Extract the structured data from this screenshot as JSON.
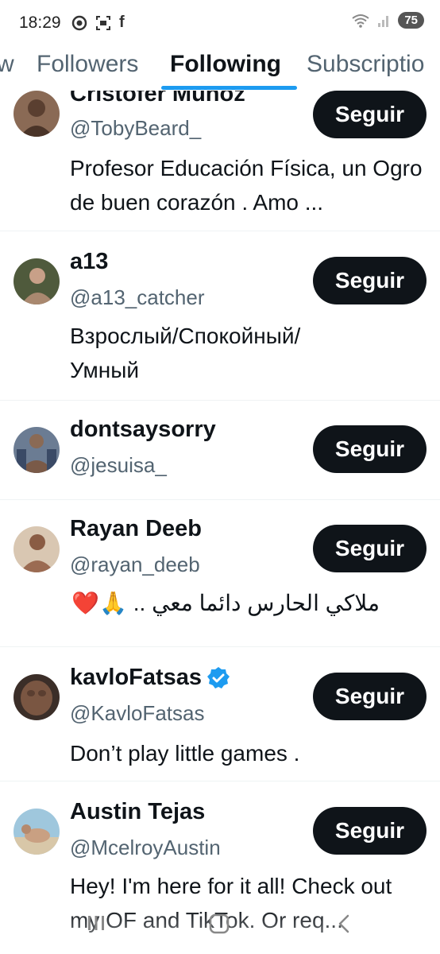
{
  "status_bar": {
    "time": "18:29",
    "left_icons": [
      "location-icon",
      "screen-record-icon",
      "facebook-icon"
    ],
    "right_icons": [
      "wifi-icon",
      "signal-icon"
    ],
    "battery": "75"
  },
  "tabs": {
    "items": [
      {
        "label": "w"
      },
      {
        "label": "Followers"
      },
      {
        "label": "Following"
      },
      {
        "label": "Subscriptio"
      }
    ],
    "active_index": 2,
    "accent_color": "#1d9bf0"
  },
  "users": [
    {
      "name": "Cristofer Muñoz",
      "handle": "@TobyBeard_",
      "bio": "Profesor Educación Física, un Ogro de buen corazón . Amo ...",
      "button": "Seguir",
      "verified": false
    },
    {
      "name": "a13",
      "handle": "@a13_catcher",
      "bio": "Взрослый/Спокойный/ Умный",
      "button": "Seguir",
      "verified": false
    },
    {
      "name": "dontsaysorry",
      "handle": "@jesuisa_",
      "bio": "",
      "button": "Seguir",
      "verified": false
    },
    {
      "name": "Rayan Deeb",
      "handle": "@rayan_deeb",
      "bio": "ملاكي الحارس دائما معي .. 🙏❤️",
      "button": "Seguir",
      "verified": false
    },
    {
      "name": "kavloFatsas",
      "handle": "@KavloFatsas",
      "bio": "Don’t play little games .",
      "button": "Seguir",
      "verified": true
    },
    {
      "name": "Austin Tejas",
      "handle": "@McelroyAustin",
      "bio": "Hey! I'm here for it all! Check out my OF and TikTok. Or req...",
      "button": "Seguir",
      "verified": false
    }
  ],
  "nav": {
    "icons": [
      "recent-apps-icon",
      "home-icon",
      "back-icon"
    ]
  }
}
